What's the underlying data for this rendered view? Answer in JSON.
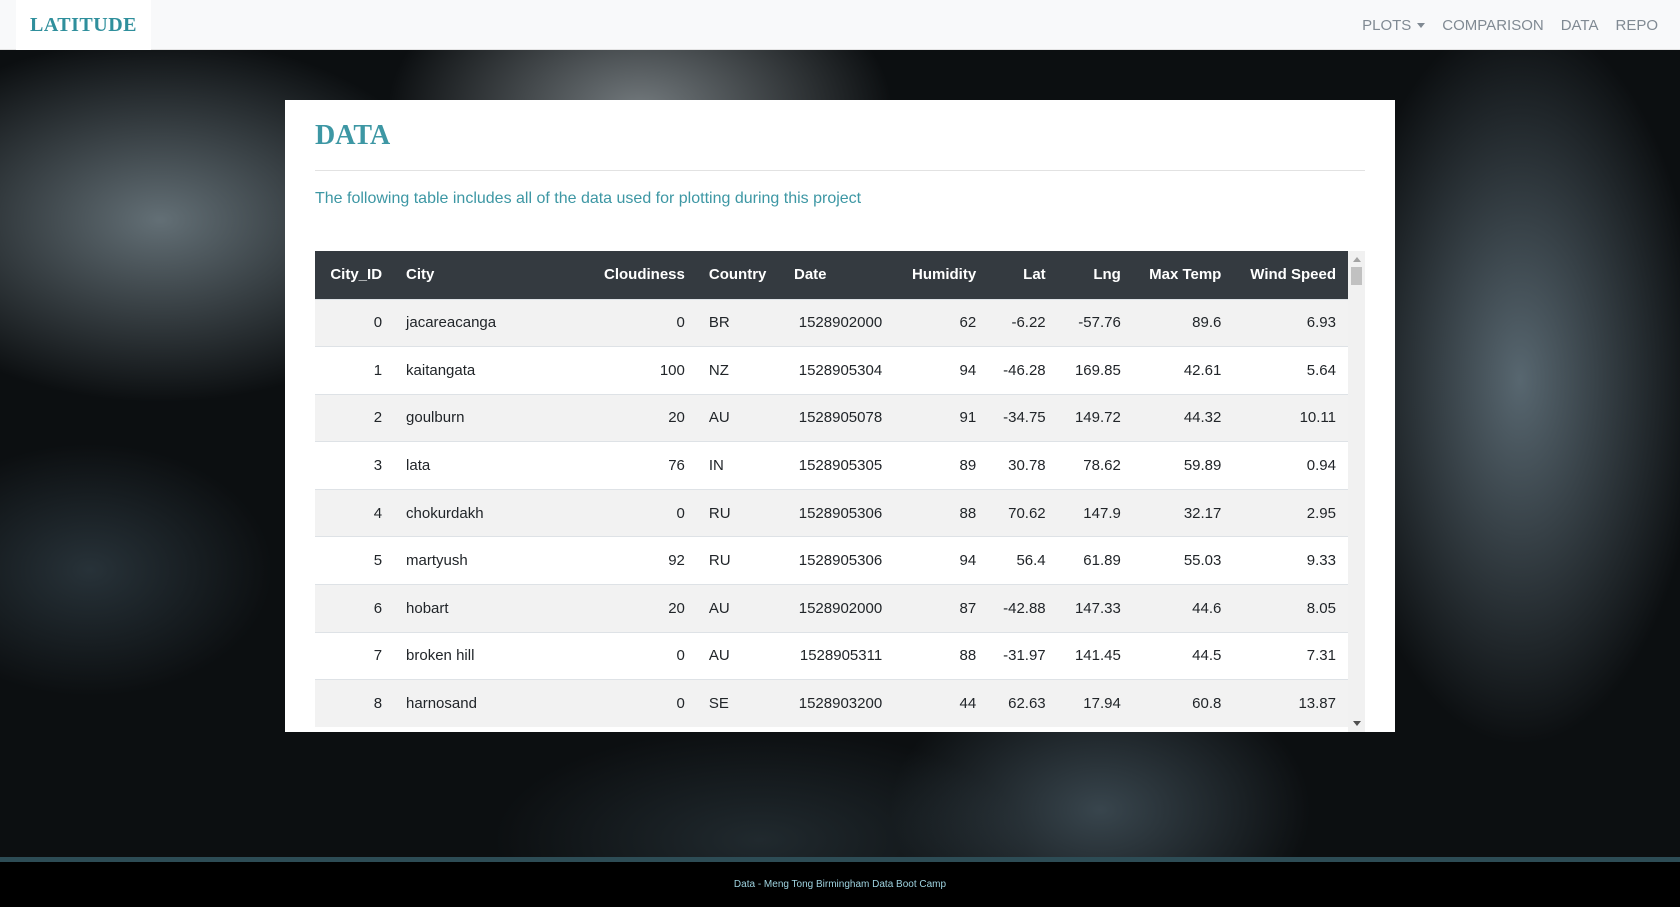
{
  "navbar": {
    "brand": "LATITUDE",
    "links": [
      {
        "label": "PLOTS",
        "dropdown": true
      },
      {
        "label": "COMPARISON"
      },
      {
        "label": "DATA"
      },
      {
        "label": "REPO"
      }
    ]
  },
  "main": {
    "title": "DATA",
    "description": "The following table includes all of the data used for plotting during this project",
    "table": {
      "columns": [
        "City_ID",
        "City",
        "Cloudiness",
        "Country",
        "Date",
        "Humidity",
        "Lat",
        "Lng",
        "Max Temp",
        "Wind Speed"
      ],
      "rows": [
        [
          "0",
          "jacareacanga",
          "0",
          "BR",
          "1528902000",
          "62",
          "-6.22",
          "-57.76",
          "89.6",
          "6.93"
        ],
        [
          "1",
          "kaitangata",
          "100",
          "NZ",
          "1528905304",
          "94",
          "-46.28",
          "169.85",
          "42.61",
          "5.64"
        ],
        [
          "2",
          "goulburn",
          "20",
          "AU",
          "1528905078",
          "91",
          "-34.75",
          "149.72",
          "44.32",
          "10.11"
        ],
        [
          "3",
          "lata",
          "76",
          "IN",
          "1528905305",
          "89",
          "30.78",
          "78.62",
          "59.89",
          "0.94"
        ],
        [
          "4",
          "chokurdakh",
          "0",
          "RU",
          "1528905306",
          "88",
          "70.62",
          "147.9",
          "32.17",
          "2.95"
        ],
        [
          "5",
          "martyush",
          "92",
          "RU",
          "1528905306",
          "94",
          "56.4",
          "61.89",
          "55.03",
          "9.33"
        ],
        [
          "6",
          "hobart",
          "20",
          "AU",
          "1528902000",
          "87",
          "-42.88",
          "147.33",
          "44.6",
          "8.05"
        ],
        [
          "7",
          "broken hill",
          "0",
          "AU",
          "1528905311",
          "88",
          "-31.97",
          "141.45",
          "44.5",
          "7.31"
        ],
        [
          "8",
          "harnosand",
          "0",
          "SE",
          "1528903200",
          "44",
          "62.63",
          "17.94",
          "60.8",
          "13.87"
        ]
      ]
    }
  },
  "footer": {
    "text": "Data - Meng Tong Birmingham Data Boot Camp"
  },
  "colors": {
    "accent": "#3d97a4",
    "header_bg": "#343a40",
    "footer_border": "#2d4c55"
  }
}
